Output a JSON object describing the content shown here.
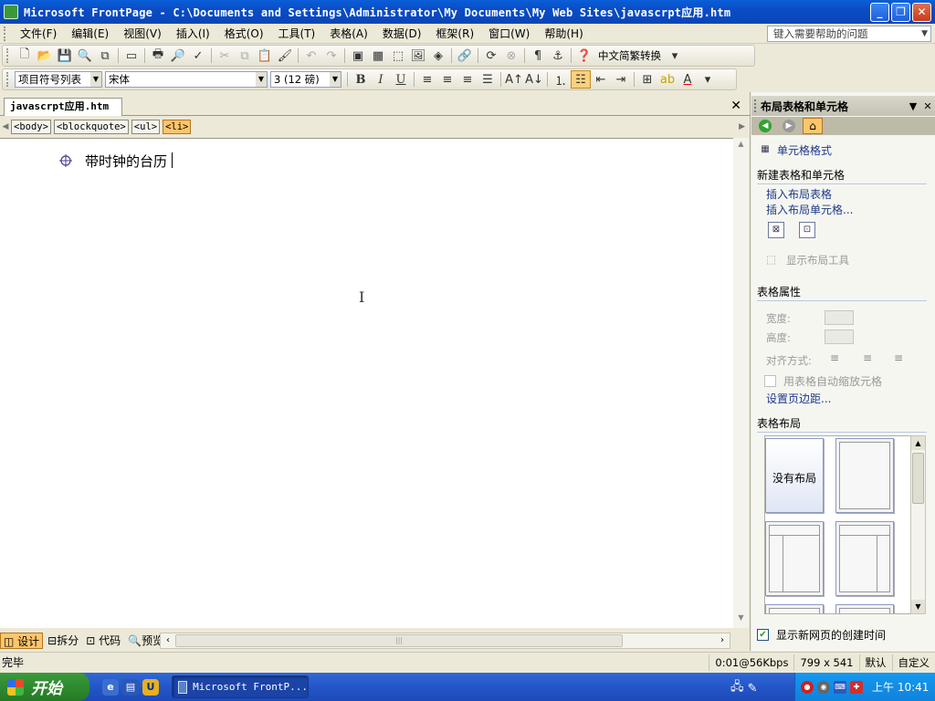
{
  "window": {
    "title": "Microsoft FrontPage - C:\\Documents and Settings\\Administrator\\My Documents\\My Web Sites\\javascrpt应用.htm",
    "minimize": "_",
    "restore": "❐",
    "close": "✕"
  },
  "menu": {
    "items": [
      "文件(F)",
      "编辑(E)",
      "视图(V)",
      "插入(I)",
      "格式(O)",
      "工具(T)",
      "表格(A)",
      "数据(D)",
      "框架(R)",
      "窗口(W)",
      "帮助(H)"
    ],
    "help_placeholder": "键入需要帮助的问题"
  },
  "toolbar1": {
    "convert_label": "中文简繁转换"
  },
  "toolbar2": {
    "style_value": "项目符号列表",
    "font_value": "宋体",
    "size_value": "3 (12 磅)",
    "bold": "B",
    "italic": "I",
    "underline": "U"
  },
  "document": {
    "tab_label": "javascrpt应用.htm",
    "close": "✕",
    "tags": [
      "<body>",
      "<blockquote>",
      "<ul>",
      "<li>"
    ],
    "content_text": "带时钟的台历"
  },
  "view_tabs": [
    "设计",
    "拆分",
    "代码",
    "预览"
  ],
  "task_pane": {
    "title": "布局表格和单元格",
    "cell_format_link": "单元格格式",
    "new_section": "新建表格和单元格",
    "insert_table_link": "插入布局表格",
    "insert_cell_link": "插入布局单元格...",
    "show_tools": "显示布局工具",
    "table_props_section": "表格属性",
    "width_label": "宽度:",
    "height_label": "高度:",
    "align_label": "对齐方式:",
    "autoscale_label": "用表格自动缩放元格",
    "margins_link": "设置页边距...",
    "layout_section": "表格布局",
    "no_layout": "没有布局",
    "show_time_label": "显示新网页的创建时间"
  },
  "status": {
    "left": "完毕",
    "download": "0:01@56Kbps",
    "size": "799 x 541",
    "mode": "默认",
    "custom": "自定义"
  },
  "taskbar": {
    "start": "开始",
    "item": "Microsoft FrontP...",
    "clock": "上午 10:41"
  }
}
